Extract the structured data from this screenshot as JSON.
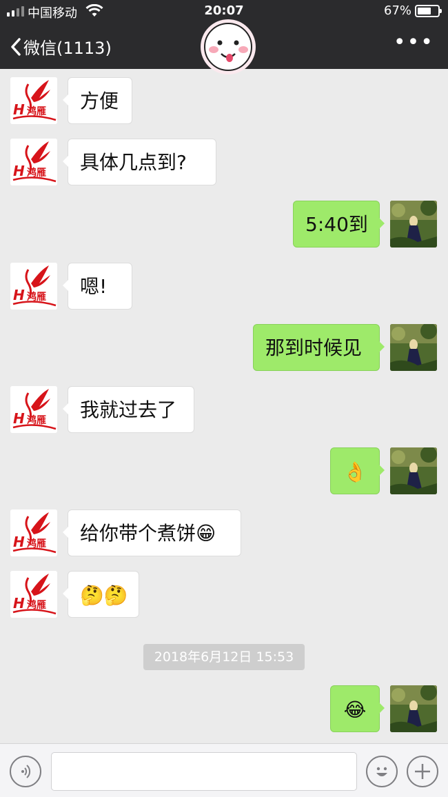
{
  "status_bar": {
    "carrier": "中国移动",
    "time": "20:07",
    "battery": "67%",
    "battery_level": 0.67
  },
  "nav": {
    "back_label": "微信(1113)",
    "more_label": "•••"
  },
  "messages": [
    {
      "side": "left",
      "text": "方便"
    },
    {
      "side": "left",
      "text": "具体几点到?"
    },
    {
      "side": "right",
      "text": "5:40到"
    },
    {
      "side": "left",
      "text": "嗯!"
    },
    {
      "side": "right",
      "text": "那到时候见"
    },
    {
      "side": "left",
      "text": "我就过去了"
    },
    {
      "side": "right",
      "text": "👌"
    },
    {
      "side": "left",
      "text": "给你带个煮饼😁"
    },
    {
      "side": "left",
      "text": "🤔🤔"
    },
    {
      "side": "right",
      "text": "😂"
    }
  ],
  "timestamp": "2018年6月12日 15:53",
  "input": {
    "value": "",
    "placeholder": ""
  },
  "icons": [
    "signal-icon",
    "wifi-icon",
    "battery-icon",
    "back-chevron-icon",
    "more-icon",
    "voice-icon",
    "emoji-icon",
    "plus-icon"
  ],
  "colors": {
    "nav_bg": "#2b2b2d",
    "chat_bg": "#ebebeb",
    "bubble_sent": "#9eea6a",
    "bubble_received": "#ffffff",
    "brand_red": "#d7141a"
  }
}
